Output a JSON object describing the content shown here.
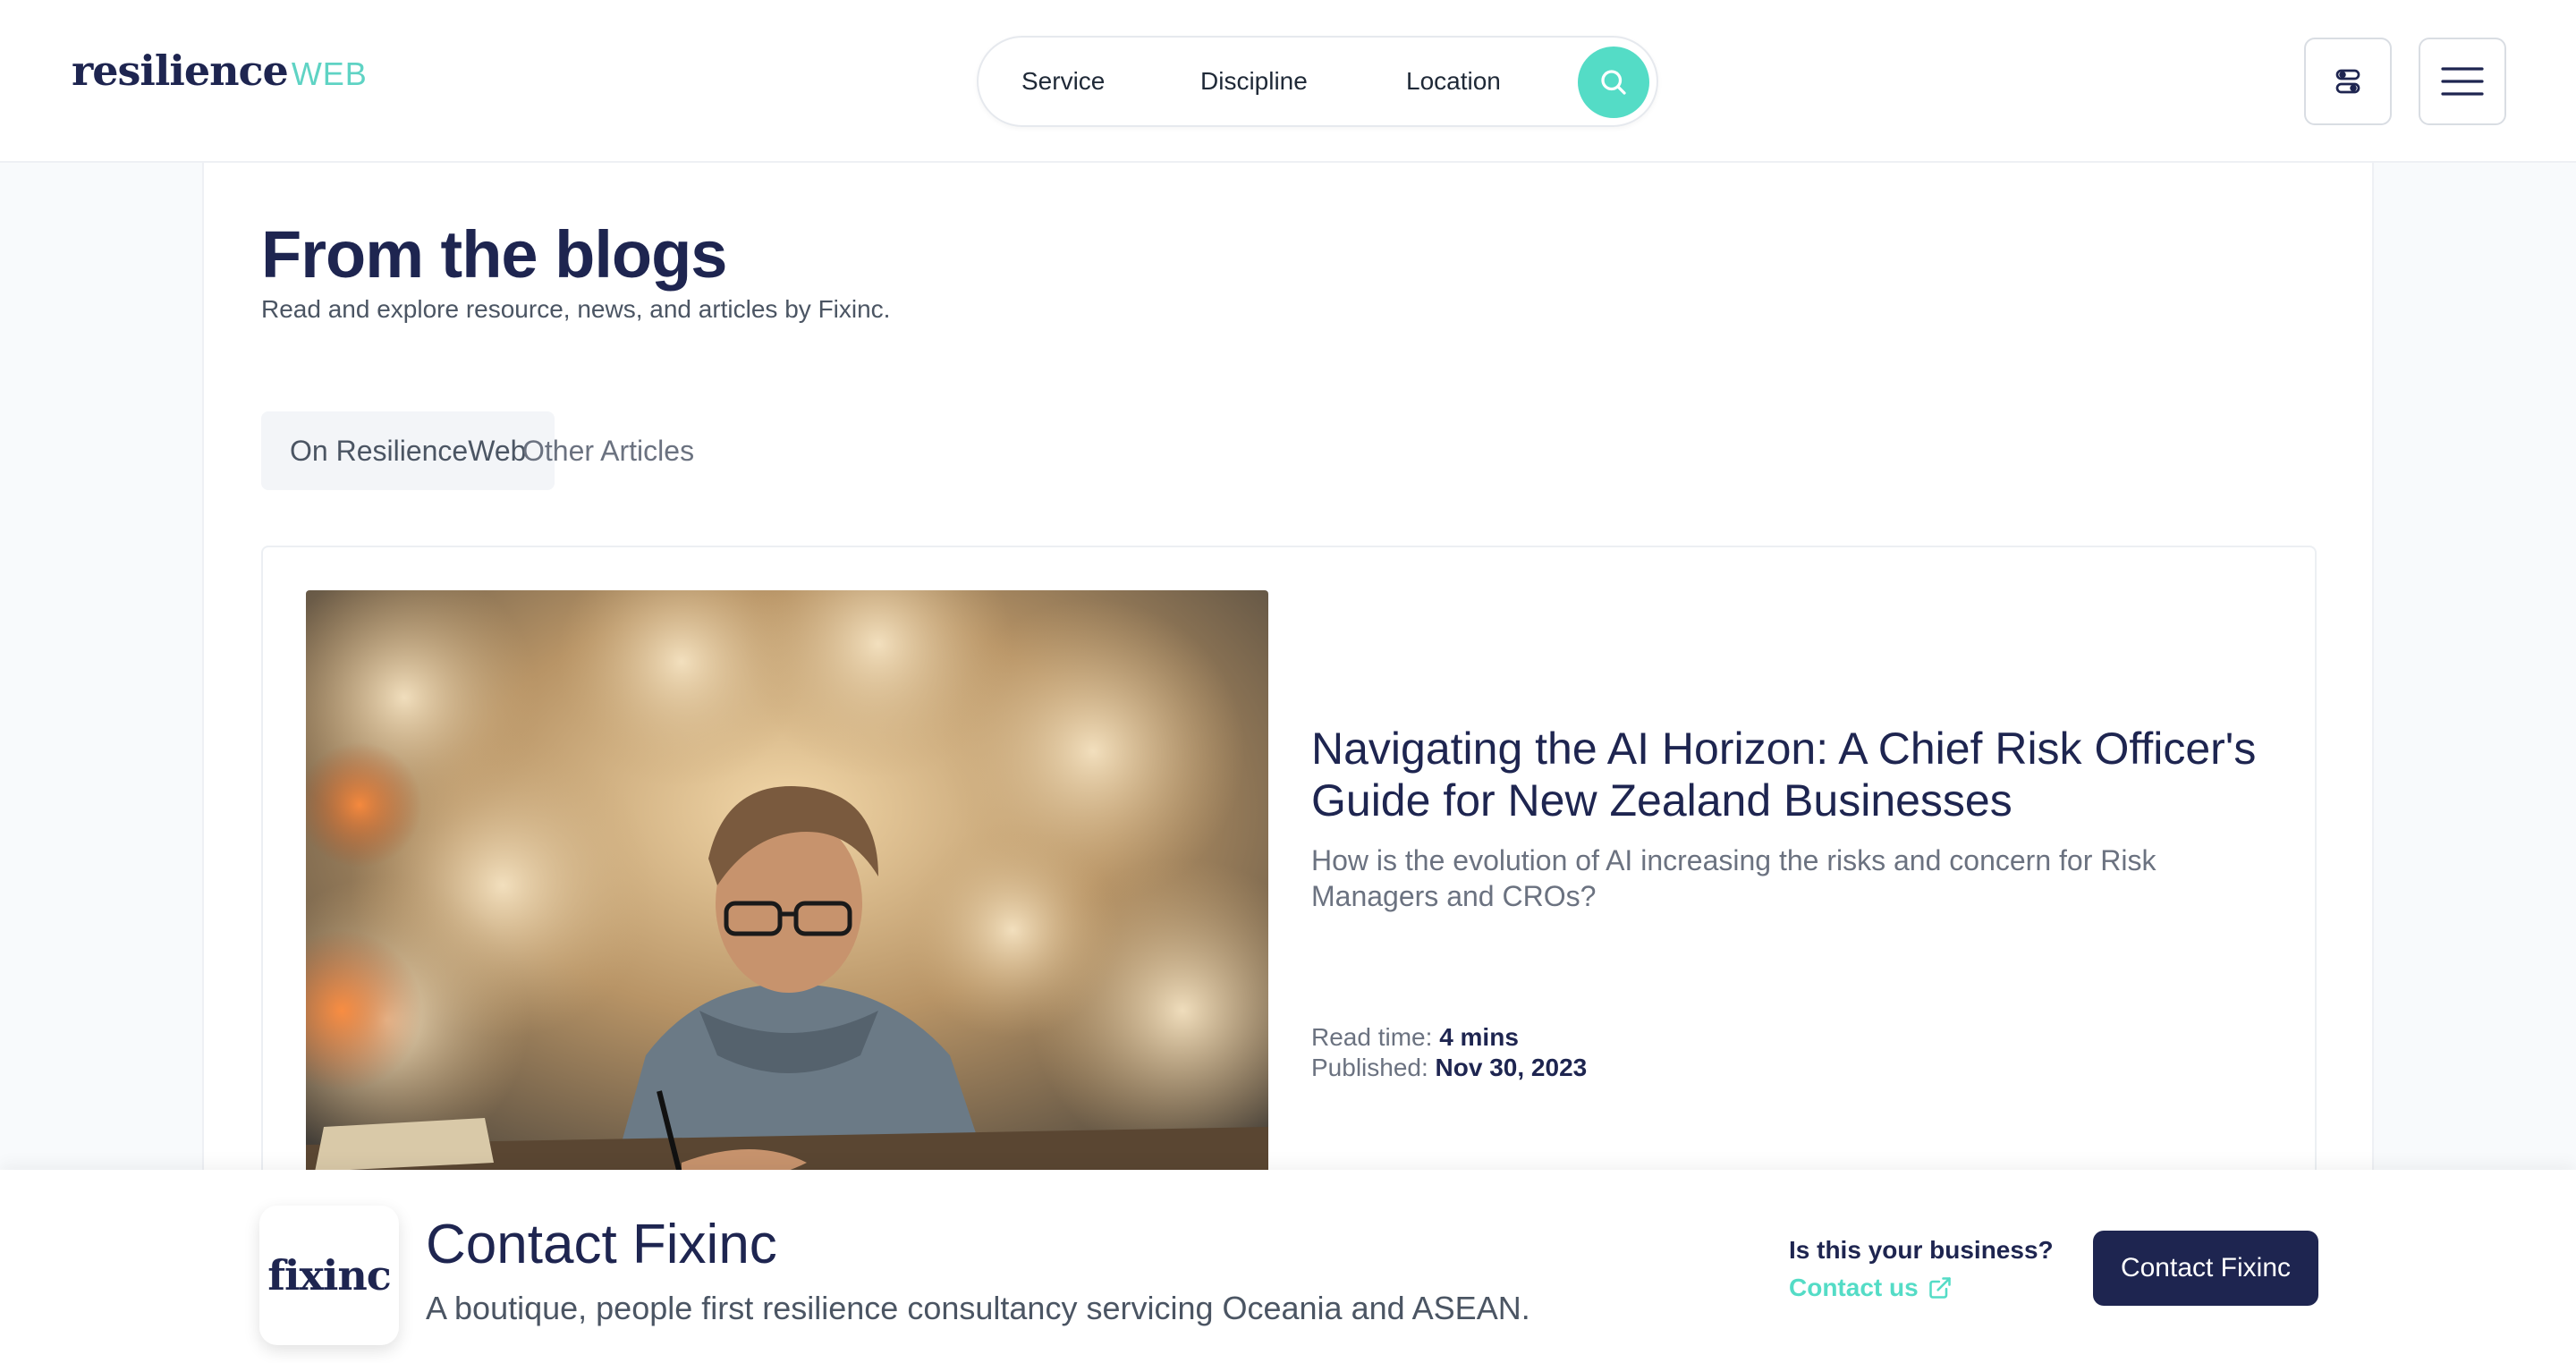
{
  "header": {
    "logo_main": "resilience",
    "logo_suffix": "WEB",
    "search": {
      "service": "Service",
      "discipline": "Discipline",
      "location": "Location"
    }
  },
  "blog": {
    "title": "From the blogs",
    "subtitle": "Read and explore resource, news, and articles by Fixinc.",
    "tabs": [
      {
        "label": "On ResilienceWeb",
        "active": true
      },
      {
        "label": "Other Articles",
        "active": false
      }
    ],
    "article": {
      "title": "Navigating the AI Horizon: A Chief Risk Officer's Guide for New Zealand Businesses",
      "description": "How is the evolution of AI increasing the risks and concern for Risk Managers and CROs?",
      "read_time_label": "Read time:",
      "read_time": "4 mins",
      "published_label": "Published:",
      "published": "Nov 30, 2023"
    }
  },
  "contact": {
    "brand": "fixinc",
    "title": "Contact Fixinc",
    "subtitle": "A boutique, people first resilience consultancy servicing Oceania and ASEAN.",
    "business_question": "Is this your business?",
    "contact_link": "Contact us",
    "button": "Contact Fixinc"
  },
  "colors": {
    "navy": "#1e2550",
    "teal": "#54dcc6"
  },
  "icons": {
    "search": "search-icon",
    "filter": "filter-toggle-icon",
    "menu": "hamburger-menu-icon",
    "external": "external-link-icon"
  }
}
